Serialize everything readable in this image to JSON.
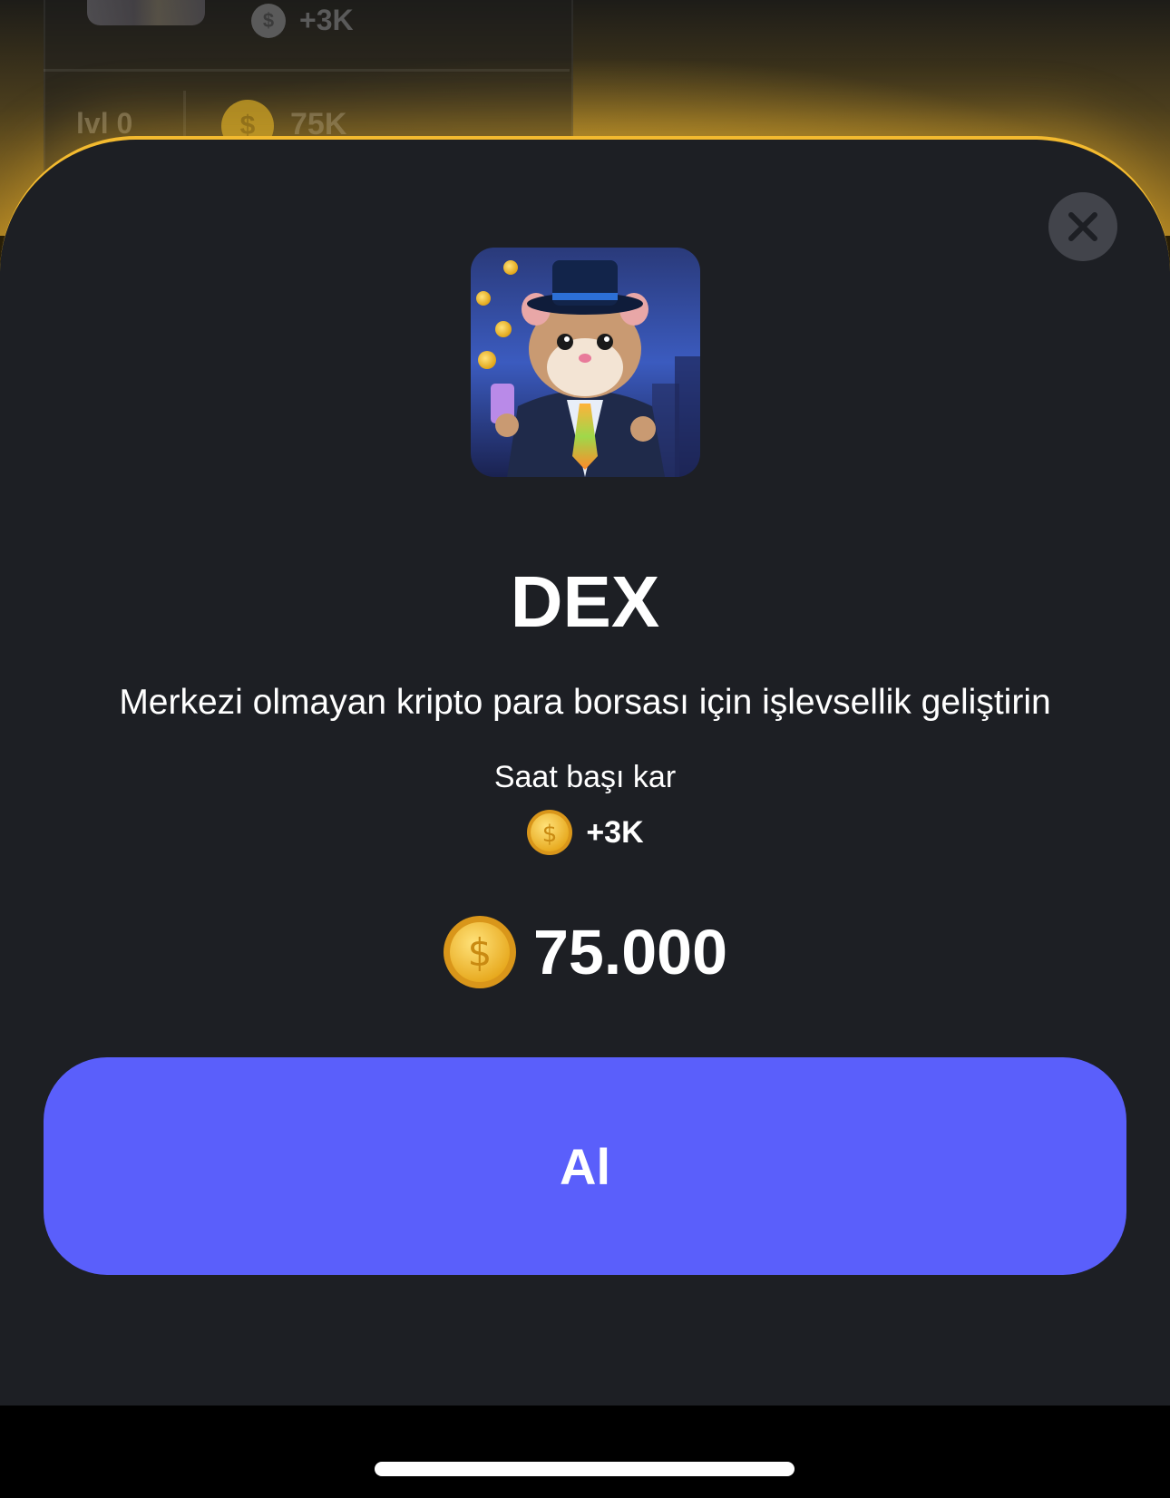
{
  "background": {
    "profit_text": "+3K",
    "level_text": "lvl 0",
    "price_text": "75K",
    "coin_symbol": "$"
  },
  "card": {
    "image_icon": "hamster-tycoon-image",
    "title": "DEX",
    "description": "Merkezi olmayan kripto para borsası için işlevsellik geliştirin",
    "profit_label": "Saat başı kar",
    "profit_value": "+3K",
    "price": "75.000",
    "coin_symbol": "$",
    "buy_label": "Al"
  },
  "colors": {
    "sheet_bg": "#1d1f24",
    "accent_gold": "#f3ba2f",
    "button_blue": "#5a5ffb",
    "close_bg": "#42444b"
  },
  "icons": {
    "close": "close-icon",
    "coin": "coin-icon"
  }
}
